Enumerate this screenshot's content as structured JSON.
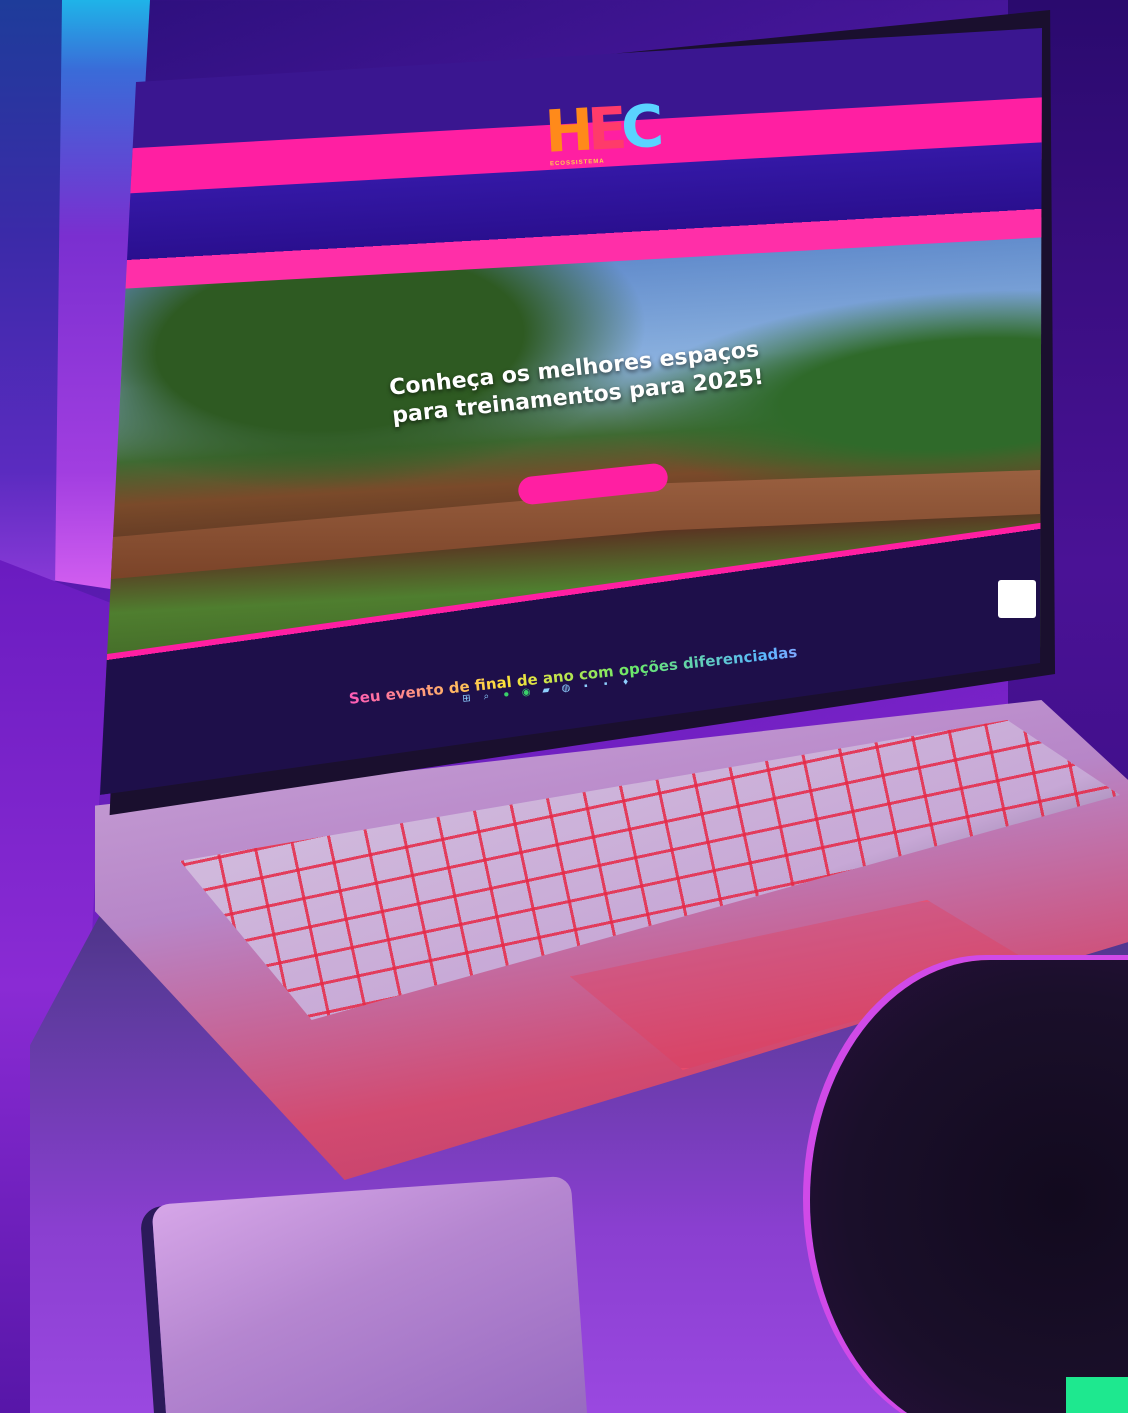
{
  "screen": {
    "top_menu": [
      "",
      "",
      "",
      "",
      "",
      "",
      "",
      "",
      "",
      "",
      "",
      "",
      "",
      "",
      "",
      "",
      ""
    ],
    "logo": {
      "h": "H",
      "e": "E",
      "c": "C",
      "subtitle": "ECOSSISTEMA"
    },
    "sub_menu": [
      "",
      "",
      "",
      "",
      "",
      "",
      "",
      "",
      "",
      "",
      "",
      "",
      "",
      "",
      ""
    ],
    "hero": {
      "title": "Conheça os melhores espaços para treinamentos para 2025!",
      "button_label": ""
    },
    "lower_section": {
      "title": "Seu evento de final de ano com opções diferenciadas"
    },
    "taskbar_icons": [
      "windows-icon",
      "search-icon",
      "xbox-icon",
      "whatsapp-icon",
      "folder-icon",
      "chrome-icon",
      "acrobat-icon",
      "photoshop-icon",
      "map-pin-icon"
    ]
  },
  "colors": {
    "brand_pink": "#ff1fa2",
    "brand_purple": "#3a1690",
    "accent_orange": "#ff7a1a",
    "accent_green": "#1ee88f"
  }
}
